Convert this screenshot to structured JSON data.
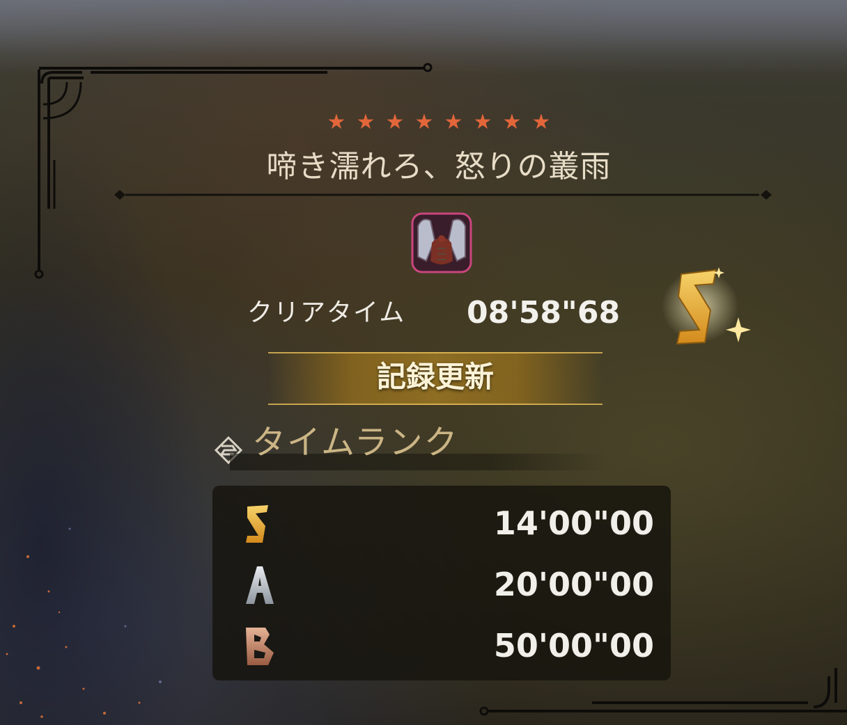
{
  "quest": {
    "star_count": 8,
    "stars": [
      "★",
      "★",
      "★",
      "★",
      "★",
      "★",
      "★",
      "★"
    ],
    "title": "啼き濡れろ、怒りの叢雨",
    "monster_icon": "rathalos-monster-icon"
  },
  "result": {
    "clear_label": "クリアタイム",
    "clear_time": "08'58\"68",
    "achieved_rank": "S",
    "record_label": "記録更新"
  },
  "time_rank": {
    "heading": "タイムランク",
    "rows": [
      {
        "rank": "S",
        "time": "14'00\"00"
      },
      {
        "rank": "A",
        "time": "20'00\"00"
      },
      {
        "rank": "B",
        "time": "50'00\"00"
      }
    ]
  },
  "colors": {
    "star": "#e2663a",
    "rank_S": "#e8b43a",
    "rank_A": "#c8ccd2",
    "rank_B": "#c98f6c",
    "record_banner": "#8d6a1f"
  }
}
